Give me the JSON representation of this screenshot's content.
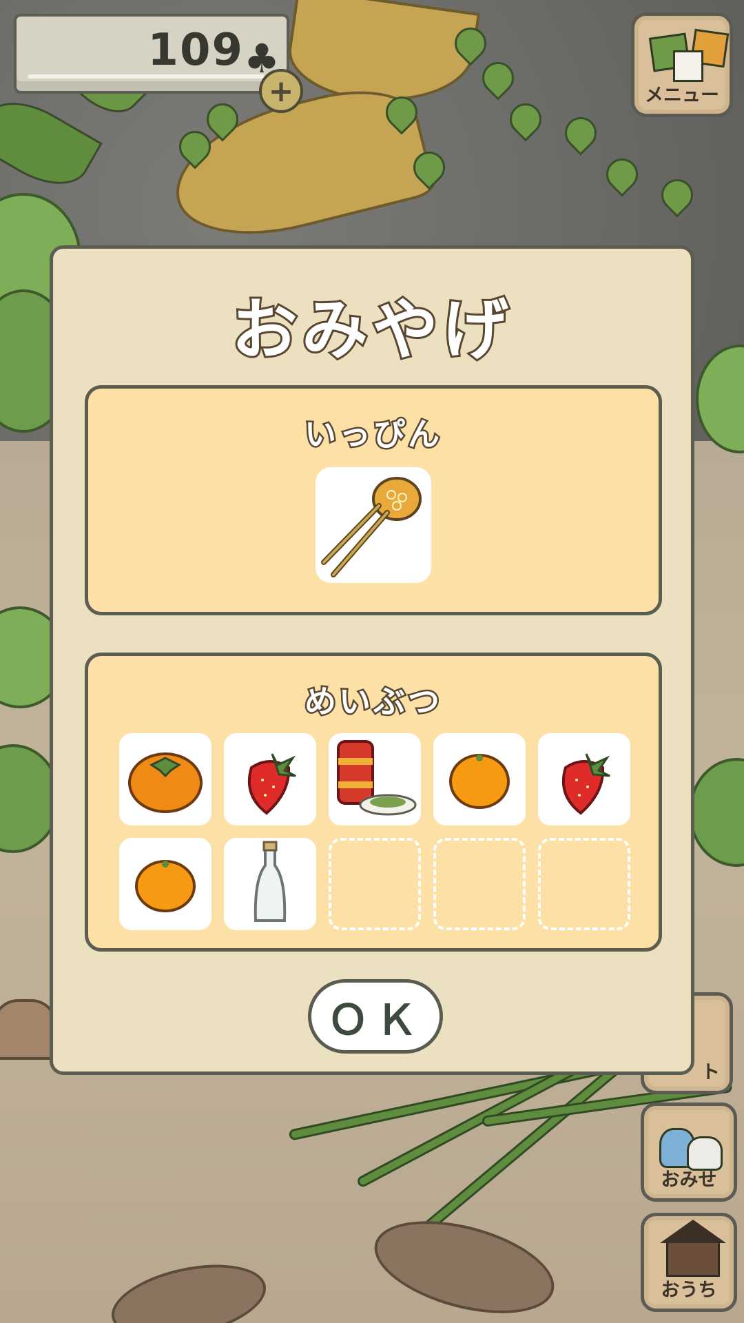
{
  "hud": {
    "clover_count": "109",
    "clover_icon": "clover-icon",
    "plus_icon": "plus-icon"
  },
  "side_menu": {
    "menu_label": "メニュー",
    "shop_label": "おみせ",
    "home_label": "おうち",
    "partial_label": "ト"
  },
  "dialog": {
    "title": "おみやげ",
    "ippin_title": "いっぴん",
    "ippin_item": "hairpin-icon",
    "meibutsu_title": "めいぶつ",
    "meibutsu_items": [
      "persimmon-icon",
      "strawberry-icon",
      "tea-tin-icon",
      "mandarin-orange-icon",
      "strawberry-icon",
      "mandarin-orange-icon",
      "glass-bottle-icon",
      "empty-slot",
      "empty-slot",
      "empty-slot"
    ],
    "ok_label": "ＯＫ"
  },
  "colors": {
    "dialog_bg": "#ebe1c1",
    "section_bg": "#fde0a6",
    "outline": "#5b5d50",
    "title_outline": "#594631"
  }
}
